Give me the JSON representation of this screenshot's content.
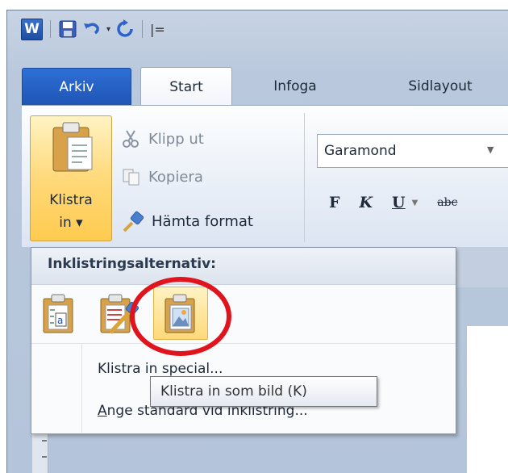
{
  "qat": {
    "app_icon": "W",
    "icons": [
      "save-icon",
      "undo-icon",
      "redo-icon",
      "customize-icon"
    ],
    "customize_glyph": "|="
  },
  "tabs": [
    {
      "label": "Arkiv",
      "active": false
    },
    {
      "label": "Start",
      "active": true
    },
    {
      "label": "Infoga",
      "active": false
    },
    {
      "label": "Sidlayout",
      "active": false
    }
  ],
  "clipboard": {
    "paste_label_line1": "Klistra",
    "paste_label_line2": "in ▾",
    "cut_label": "Klipp ut",
    "copy_label": "Kopiera",
    "format_painter_label": "Hämta format"
  },
  "font": {
    "name": "Garamond",
    "bold_label": "F",
    "italic_label": "K",
    "underline_label": "U",
    "strike_label": "abc"
  },
  "paste_menu": {
    "header": "Inklistringsalternativ:",
    "options": [
      "keep-text-only-icon",
      "merge-formatting-icon",
      "paste-as-picture-icon"
    ],
    "selected_option": 3,
    "item_paste_special": "Klistra in special...",
    "item_set_default_prefix": "A",
    "item_set_default_rest": "nge standard vid inklistring..."
  },
  "tooltip": {
    "text": "Klistra in som bild (K)"
  },
  "colors": {
    "file_tab": "#2e6fd6",
    "highlight": "#ffd97a",
    "annotation": "#e0141c"
  }
}
